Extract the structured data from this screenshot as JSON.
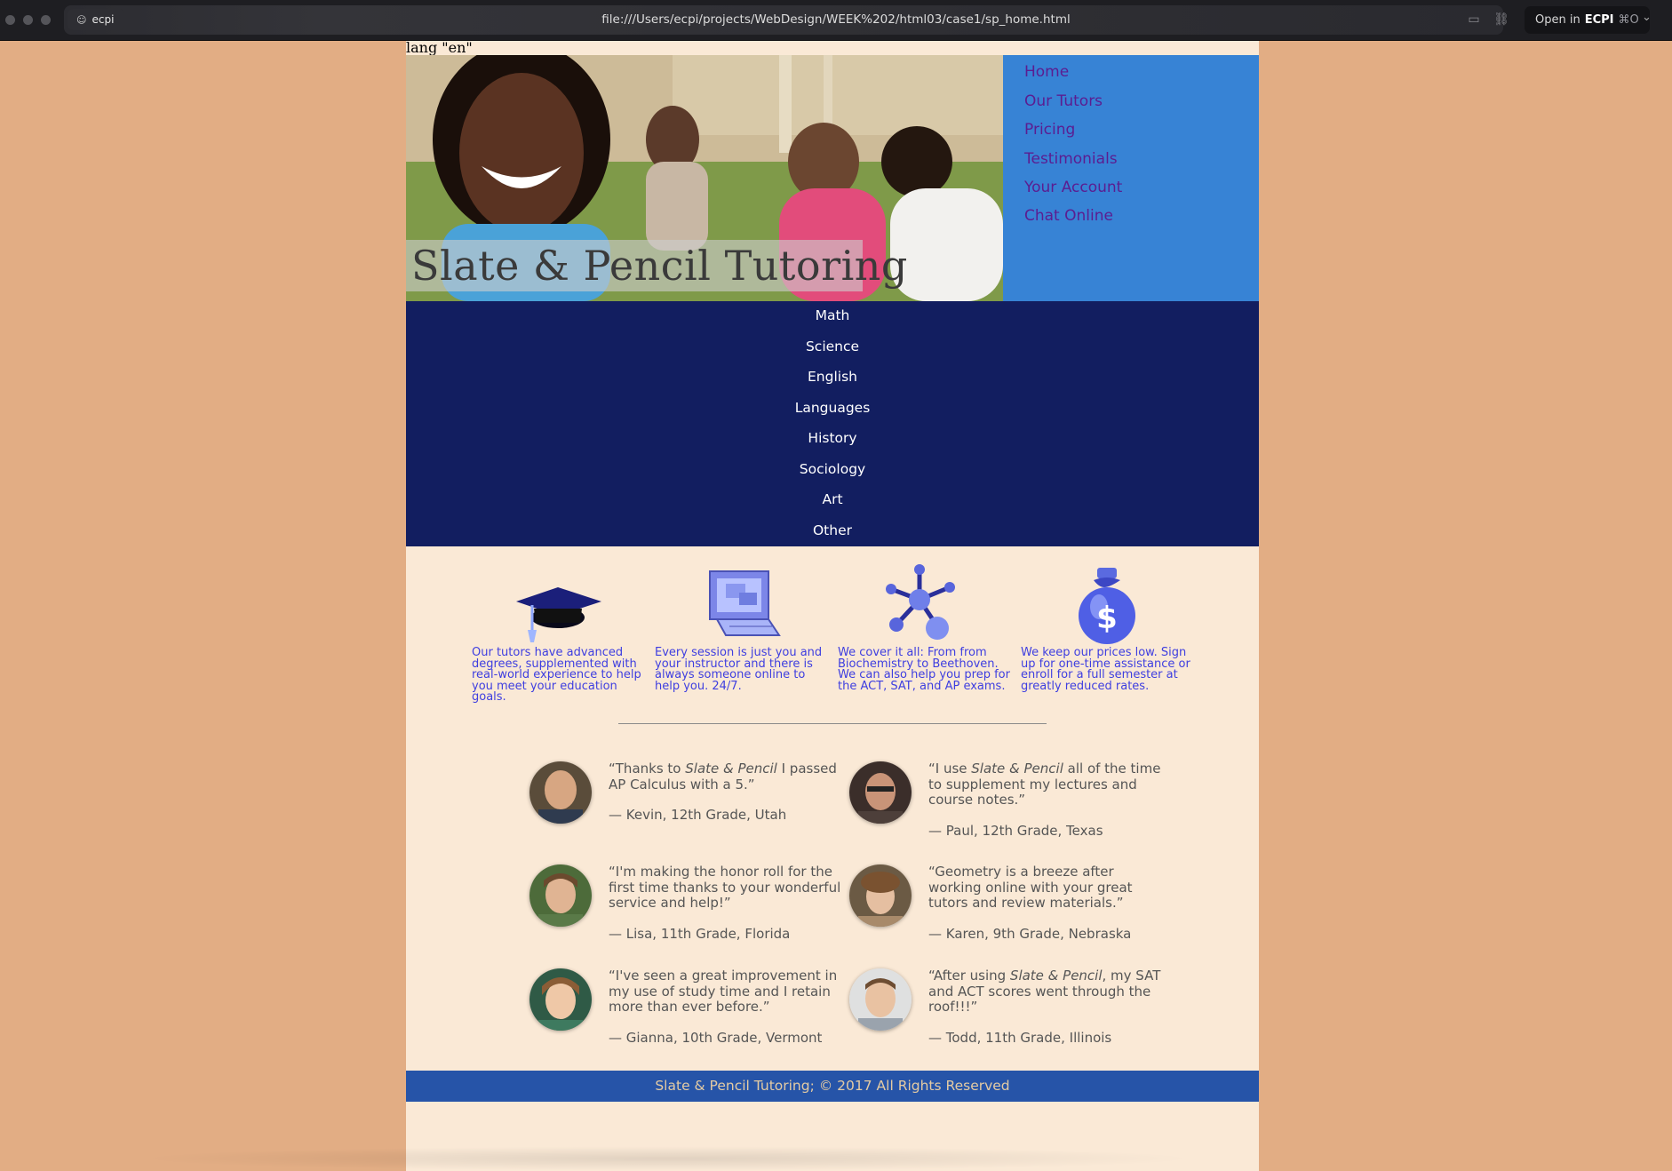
{
  "browser": {
    "profile": "ecpi",
    "url": "file:///Users/ecpi/projects/WebDesign/WEEK%202/html03/case1/sp_home.html",
    "open_in_prefix": "Open in",
    "open_in_app": "ECPI",
    "open_in_shortcut": "⌘O"
  },
  "page": {
    "lang_text": "lang \"en\"",
    "logo_text": "Slate & Pencil Tutoring",
    "top_nav": [
      "Home",
      "Our Tutors",
      "Pricing",
      "Testimonials",
      "Your Account",
      "Chat Online"
    ],
    "subject_nav": [
      "Math",
      "Science",
      "English",
      "Languages",
      "History",
      "Sociology",
      "Art",
      "Other"
    ],
    "features": [
      {
        "icon": "graduation-cap-icon",
        "text": "Our tutors have advanced degrees, supplemented with real-world experience to help you meet your education goals."
      },
      {
        "icon": "computer-icon",
        "text": "Every session is just you and your instructor and there is always someone online to help you. 24/7."
      },
      {
        "icon": "molecule-icon",
        "text": "We cover it all: From from Biochemistry to Beethoven. We can also help you prep for the ACT, SAT, and AP exams."
      },
      {
        "icon": "money-bag-icon",
        "text": "We keep our prices low. Sign up for one-time assistance or enroll for a full semester at greatly reduced rates."
      }
    ],
    "testimonials": [
      {
        "quote_pre": "“Thanks to ",
        "quote_em": "Slate & Pencil",
        "quote_post": " I passed AP Calculus with a 5.”",
        "author": "— Kevin, 12th Grade, Utah"
      },
      {
        "quote_pre": "“I use ",
        "quote_em": "Slate & Pencil",
        "quote_post": " all of the time to supplement my lectures and course notes.”",
        "author": "— Paul, 12th Grade, Texas"
      },
      {
        "quote_pre": "“I'm making the honor roll for the first time thanks to your wonderful service and help!”",
        "quote_em": "",
        "quote_post": "",
        "author": "— Lisa, 11th Grade, Florida"
      },
      {
        "quote_pre": "“Geometry is a breeze after working online with your great tutors and review materials.”",
        "quote_em": "",
        "quote_post": "",
        "author": "— Karen, 9th Grade, Nebraska"
      },
      {
        "quote_pre": "“I've seen a great improvement in my use of study time and I retain more than ever before.”",
        "quote_em": "",
        "quote_post": "",
        "author": "— Gianna, 10th Grade, Vermont"
      },
      {
        "quote_pre": "“After using ",
        "quote_em": "Slate & Pencil",
        "quote_post": ", my SAT and ACT scores went through the roof!!!”",
        "author": "— Todd, 11th Grade, Illinois"
      }
    ],
    "footer": "Slate & Pencil Tutoring; © 2017 All Rights Reserved"
  },
  "colors": {
    "body_bg": "#E2AD84",
    "page_bg": "#FAE9D6",
    "top_nav_bg": "#3783D5",
    "top_nav_link": "#5B1D91",
    "subject_nav_bg": "#121E60",
    "feature_text": "#3E3EE0",
    "footer_bg": "#2654A8",
    "footer_text": "#E4CBA3"
  }
}
